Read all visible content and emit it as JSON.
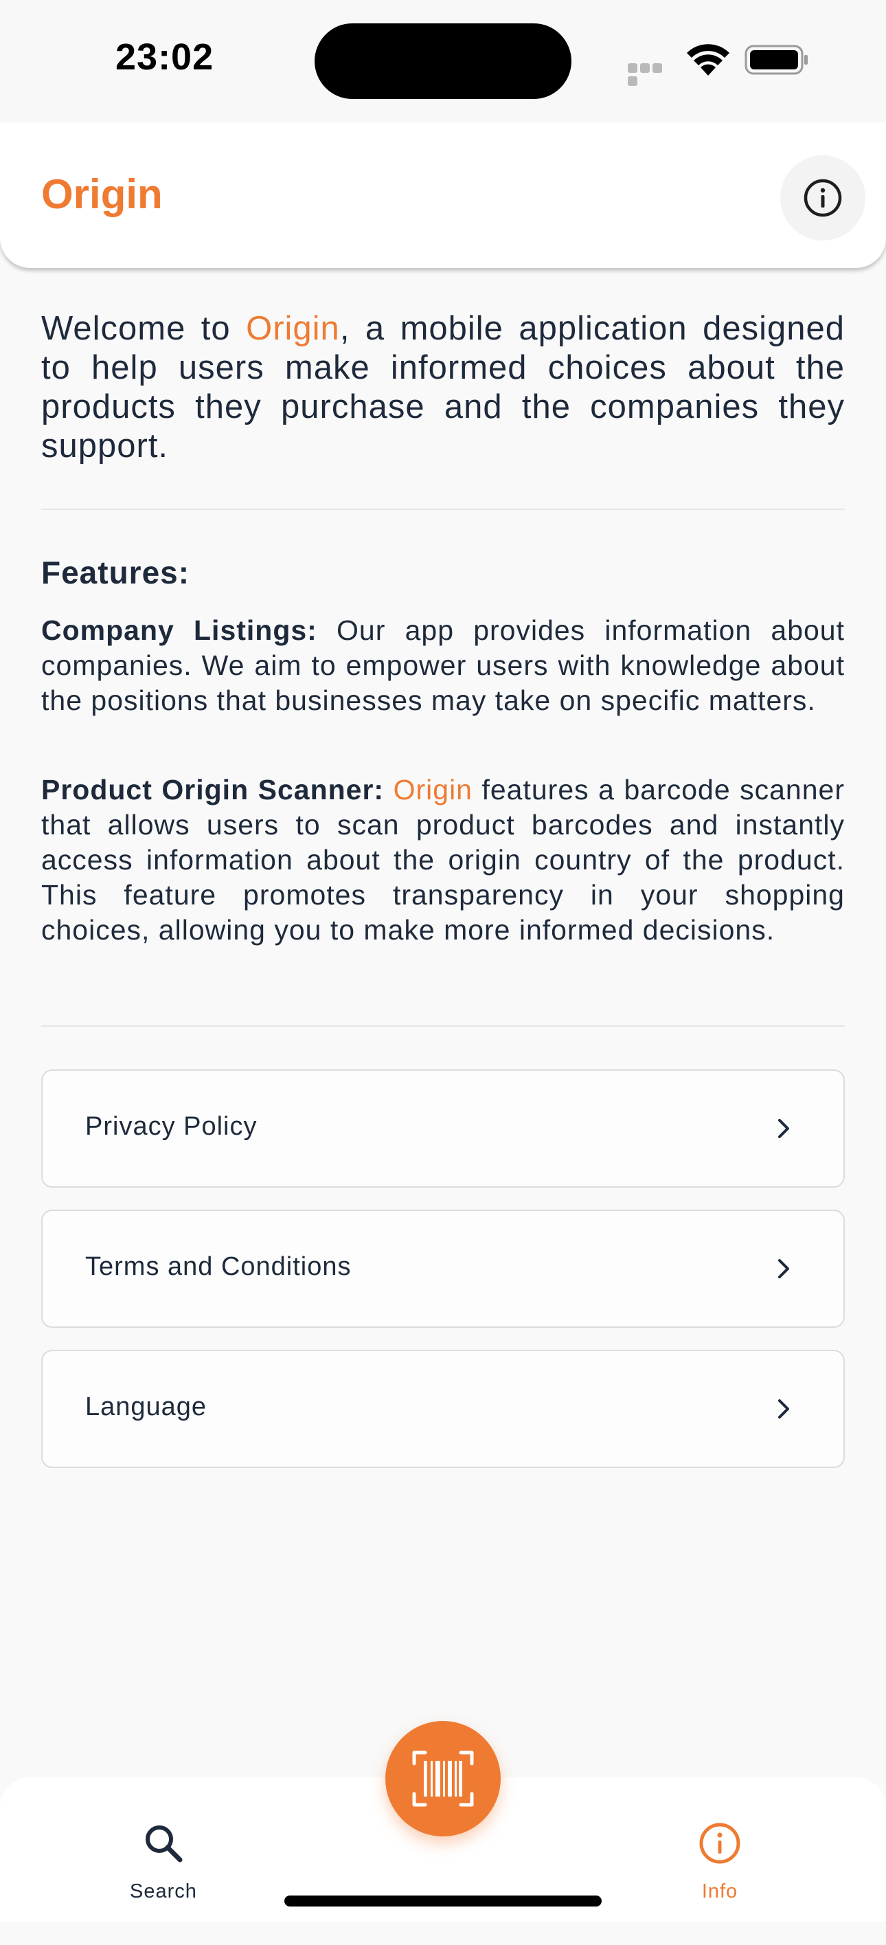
{
  "status_bar": {
    "time": "23:02"
  },
  "header": {
    "title": "Origin",
    "info_icon": "info-icon"
  },
  "welcome": {
    "prefix": "Welcome to ",
    "brand": "Origin",
    "suffix": ", a mobile application designed to help users make informed choices about the products they purchase and the companies they support."
  },
  "features": {
    "title": "Features:",
    "items": [
      {
        "label": "Company Listings:",
        "text": " Our app provides information about companies. We aim to empower users with knowledge about the positions that businesses may take on specific matters."
      },
      {
        "label": "Product Origin Scanner:",
        "brand": "Origin",
        "text": " features a barcode scanner that allows users to scan product barcodes and instantly access information about the origin country of the product. This feature promotes transparency in your shopping choices, allowing you to make more informed decisions."
      }
    ]
  },
  "menu": [
    {
      "label": "Privacy Policy",
      "icon": "chevron-right-icon"
    },
    {
      "label": "Terms and Conditions",
      "icon": "chevron-right-icon"
    },
    {
      "label": "Language",
      "icon": "chevron-right-icon"
    }
  ],
  "bottom_nav": {
    "tabs": [
      {
        "label": "Search",
        "icon": "search-icon",
        "active": false
      },
      {
        "label": "Info",
        "icon": "info-icon",
        "active": true
      }
    ],
    "scan_button_icon": "barcode-scan-icon"
  },
  "colors": {
    "accent": "#ef7b33",
    "text": "#1e2a3b",
    "background": "#f9f9f9"
  }
}
